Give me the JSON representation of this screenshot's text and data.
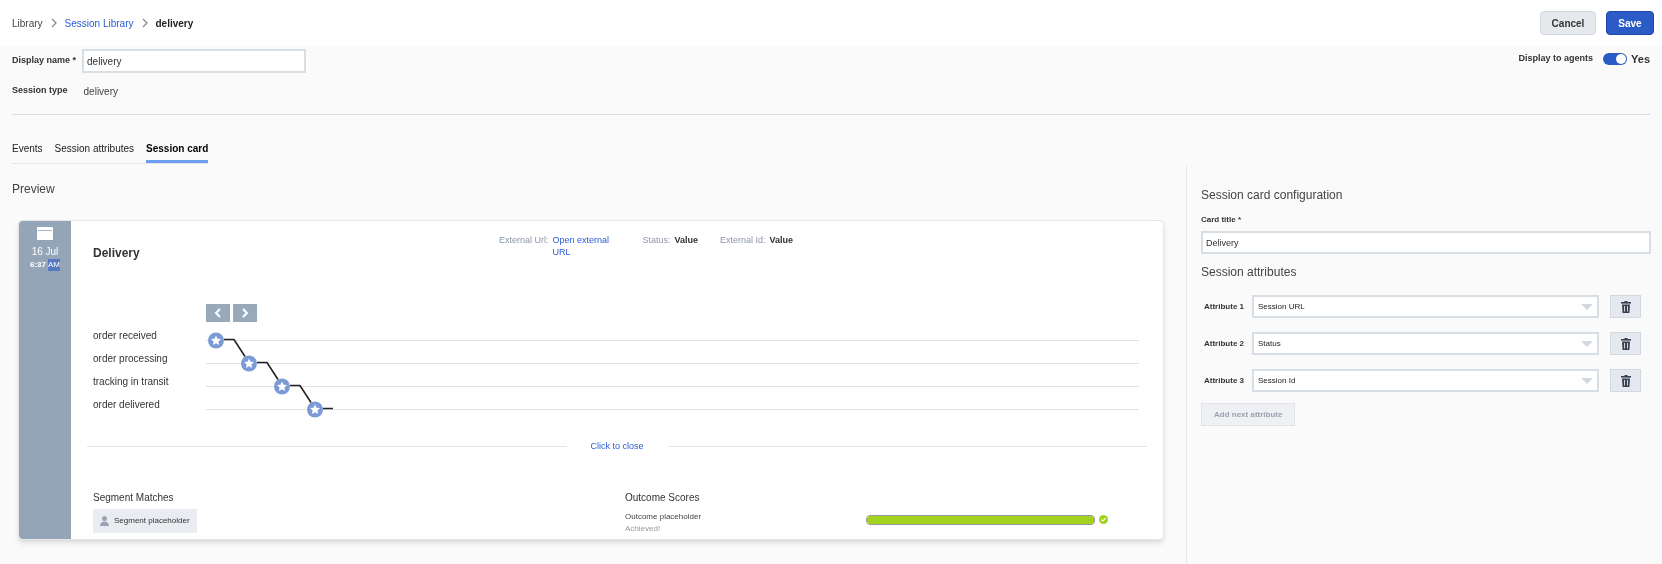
{
  "breadcrumb": [
    {
      "label": "Library",
      "kind": "plain"
    },
    {
      "label": "Session Library",
      "kind": "link"
    },
    {
      "label": "delivery",
      "kind": "current"
    }
  ],
  "header_buttons": [
    {
      "label": "Cancel",
      "kind": "secondary"
    },
    {
      "label": "Save",
      "kind": "primary"
    }
  ],
  "display_name": {
    "label": "Display name *",
    "value": "delivery"
  },
  "display_to_agents": {
    "label": "Display to agents",
    "on": true,
    "state_text": "Yes"
  },
  "session_type": {
    "label": "Session type",
    "value": "delivery"
  },
  "tabs": [
    {
      "label": "Events",
      "selected": false
    },
    {
      "label": "Session attributes",
      "selected": false
    },
    {
      "label": "Session card",
      "selected": true
    }
  ],
  "preview": {
    "title": "Preview",
    "card": {
      "date": "16 Jul",
      "time": "6:37",
      "meridiem": "AM",
      "title": "Delivery",
      "fields": [
        {
          "label": "External Url:",
          "value": "Open external URL",
          "kind": "link"
        },
        {
          "label": "Status:",
          "value": "Value",
          "kind": "text"
        },
        {
          "label": "External Id:",
          "value": "Value",
          "kind": "text"
        }
      ],
      "events": [
        "order received",
        "order processing",
        "tracking in transit",
        "order delivered"
      ],
      "close_link": "Click to close",
      "segments": {
        "title": "Segment Matches",
        "items": [
          "Segment placeholder"
        ]
      },
      "outcomes": {
        "title": "Outcome Scores",
        "items": [
          {
            "name": "Outcome placeholder",
            "status": "Achieved!",
            "level": 1.0,
            "achieved": true
          }
        ]
      }
    }
  },
  "config": {
    "title": "Session card configuration",
    "card_title": {
      "label": "Card title *",
      "value": "Delivery"
    },
    "attributes_title": "Session attributes",
    "attributes": [
      {
        "label": "Attribute 1",
        "value": "Session URL"
      },
      {
        "label": "Attribute 2",
        "value": "Status"
      },
      {
        "label": "Attribute 3",
        "value": "Session Id"
      }
    ],
    "add_button": {
      "label": "Add next attribute",
      "disabled": true
    }
  }
}
